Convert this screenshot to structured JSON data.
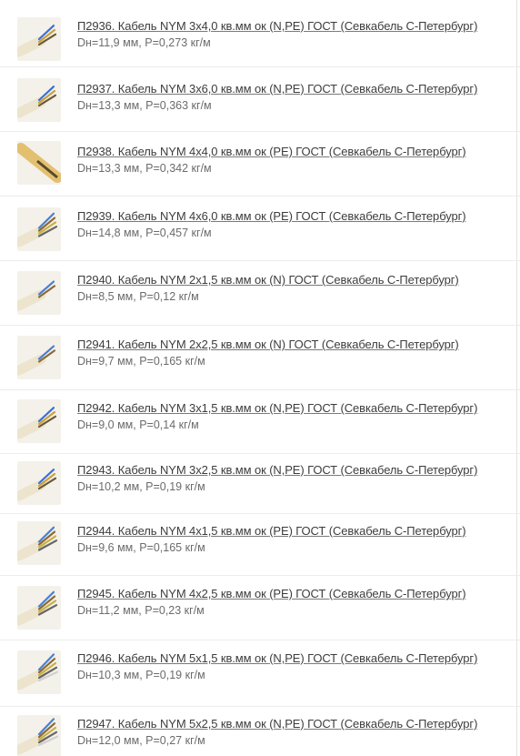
{
  "products": [
    {
      "title": "П2936. Кабель NYM 3х4,0 кв.мм ок (N,PE) ГОСТ (Севкабель С-Петербург)",
      "spec": "Dн=11,9 мм, P=0,273 кг/м",
      "image": "cable-3-core-image"
    },
    {
      "title": "П2937. Кабель NYM 3х6,0 кв.мм ок (N,PE) ГОСТ (Севкабель С-Петербург)",
      "spec": "Dн=13,3 мм, P=0,363 кг/м",
      "image": "cable-3-core-image"
    },
    {
      "title": "П2938. Кабель NYM 4х4,0 кв.мм ок (PE) ГОСТ (Севкабель С-Петербург)",
      "spec": "Dн=13,3 мм, P=0,342 кг/м",
      "image": "cable-yellow-image"
    },
    {
      "title": "П2939. Кабель NYM 4х6,0 кв.мм ок (PE) ГОСТ (Севкабель С-Петербург)",
      "spec": "Dн=14,8 мм, P=0,457 кг/м",
      "image": "cable-4-core-image"
    },
    {
      "title": "П2940. Кабель NYM 2х1,5 кв.мм ок (N) ГОСТ (Севкабель С-Петербург)",
      "spec": "Dн=8,5 мм, P=0,12 кг/м",
      "image": "cable-2-core-image"
    },
    {
      "title": "П2941. Кабель NYM 2х2,5 кв.мм ок (N) ГОСТ (Севкабель С-Петербург)",
      "spec": "Dн=9,7 мм, P=0,165 кг/м",
      "image": "cable-2-core-image"
    },
    {
      "title": "П2942. Кабель NYM 3х1,5 кв.мм ок (N,PE) ГОСТ (Севкабель С-Петербург)",
      "spec": "Dн=9,0 мм, P=0,14 кг/м",
      "image": "cable-3-core-image"
    },
    {
      "title": "П2943. Кабель NYM 3х2,5 кв.мм ок (N,PE) ГОСТ (Севкабель С-Петербург)",
      "spec": "Dн=10,2 мм, P=0,19 кг/м",
      "image": "cable-3-core-image"
    },
    {
      "title": "П2944. Кабель NYM 4х1,5 кв.мм ок (PE) ГОСТ (Севкабель С-Петербург)",
      "spec": "Dн=9,6 мм, P=0,165 кг/м",
      "image": "cable-4-core-image"
    },
    {
      "title": "П2945. Кабель NYM 4х2,5 кв.мм ок (PE) ГОСТ (Севкабель С-Петербург)",
      "spec": "Dн=11,2 мм, P=0,23 кг/м",
      "image": "cable-4-core-image"
    },
    {
      "title": "П2946. Кабель NYM 5х1,5 кв.мм ок (N,PE) ГОСТ (Севкабель С-Петербург)",
      "spec": "Dн=10,3 мм, P=0,19 кг/м",
      "image": "cable-5-core-image"
    },
    {
      "title": "П2947. Кабель NYM 5х2,5 кв.мм ок (N,PE) ГОСТ (Севкабель С-Петербург)",
      "spec": "Dн=12,0 мм, P=0,27 кг/м",
      "image": "cable-5-core-image"
    }
  ],
  "colors": {
    "title_text": "#3c3c3c",
    "spec_text": "#6b6b6b",
    "divider": "#ececec",
    "jacket": "#ece4cc"
  }
}
